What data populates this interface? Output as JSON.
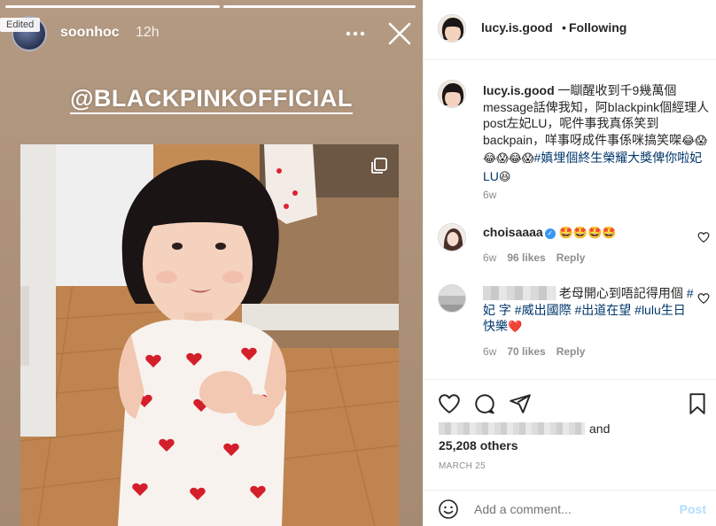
{
  "story": {
    "edited_label": "Edited",
    "username": "soonhoc",
    "time": "12h",
    "more_icon": "more-horizontal-icon",
    "close_icon": "close-icon",
    "mention": "@BLACKPINKOFFICIAL"
  },
  "post": {
    "header": {
      "username": "lucy.is.good",
      "separator": "•",
      "follow_state": "Following"
    },
    "caption": {
      "username": "lucy.is.good",
      "text_1": "一瞓醒收到千9幾萬個message話俾我知，阿blackpink個經理人post左妃LU，呢件事我真係笑到backpain，咩事呀成件事係咪搞笑㗎",
      "emoji_1": "😂😱😂😱😂😱",
      "hashtag": "#嫃埋個終生榮耀大獎俾你啦妃LU",
      "emoji_2": "😆",
      "age": "6w"
    },
    "comments": [
      {
        "username": "choisaaaa",
        "text": "🤩🤩🤩🤩",
        "age": "6w",
        "likes": "96 likes",
        "reply": "Reply"
      },
      {
        "text_1": "老母開心到唔記得用個",
        "tags": [
          "#妃",
          "字",
          "#威出國際",
          "#出道在望",
          "#lulu生日快樂"
        ],
        "emoji": "❤️",
        "age": "6w",
        "likes": "70 likes",
        "reply": "Reply"
      }
    ],
    "likes_suffix": "and",
    "likes_count": "25,208 others",
    "date": "MARCH 25",
    "comment_placeholder": "Add a comment...",
    "post_label": "Post"
  },
  "colors": {
    "story_bg": "#b09680",
    "link": "#00376b",
    "verified": "#3897f0",
    "post_disabled": "#b2dffc",
    "muted": "#8e8e8e"
  }
}
